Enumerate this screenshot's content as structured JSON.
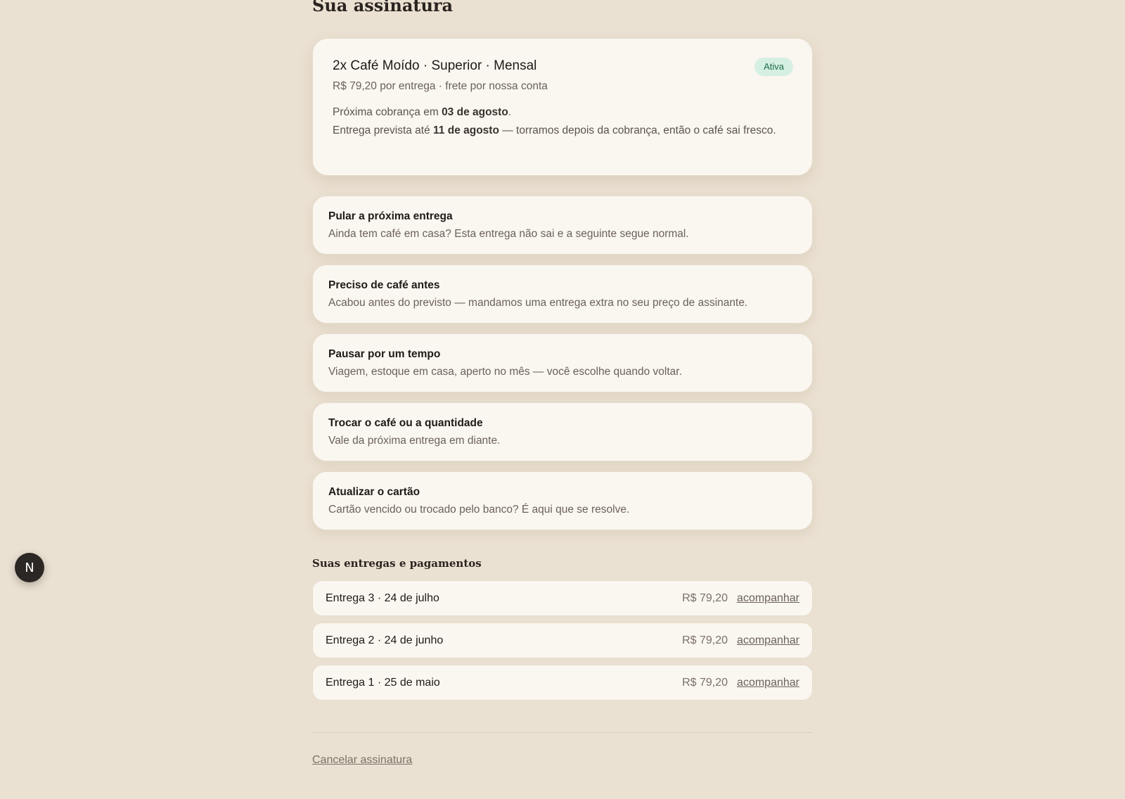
{
  "page": {
    "title": "Sua assinatura"
  },
  "subscription": {
    "title": "2x Café Moído · Superior · Mensal",
    "status": "Ativa",
    "price_line": "R$ 79,20 por entrega · frete por nossa conta",
    "next_charge_prefix": "Próxima cobrança em ",
    "next_charge_date": "03 de agosto",
    "next_charge_suffix": ".",
    "eta_prefix": "Entrega prevista até ",
    "eta_date": "11 de agosto",
    "eta_suffix": " — torramos depois da cobrança, então o café sai fresco."
  },
  "actions": [
    {
      "title": "Pular a próxima entrega",
      "description": "Ainda tem café em casa? Esta entrega não sai e a seguinte segue normal."
    },
    {
      "title": "Preciso de café antes",
      "description": "Acabou antes do previsto — mandamos uma entrega extra no seu preço de assinante."
    },
    {
      "title": "Pausar por um tempo",
      "description": "Viagem, estoque em casa, aperto no mês — você escolhe quando voltar."
    },
    {
      "title": "Trocar o café ou a quantidade",
      "description": "Vale da próxima entrega em diante."
    },
    {
      "title": "Atualizar o cartão",
      "description": "Cartão vencido ou trocado pelo banco? É aqui que se resolve."
    }
  ],
  "deliveries": {
    "section_title": "Suas entregas e pagamentos",
    "items": [
      {
        "label": "Entrega 3 · 24 de julho",
        "amount": "R$ 79,20",
        "link": "acompanhar"
      },
      {
        "label": "Entrega 2 · 24 de junho",
        "amount": "R$ 79,20",
        "link": "acompanhar"
      },
      {
        "label": "Entrega 1 · 25 de maio",
        "amount": "R$ 79,20",
        "link": "acompanhar"
      }
    ]
  },
  "footer": {
    "cancel_label": "Cancelar assinatura"
  },
  "fab": {
    "label": "N",
    "icon": "next-logo-icon"
  },
  "colors": {
    "background": "#ebe1d2",
    "card": "#faf6f0",
    "badge_bg": "#d5f0e2",
    "badge_text": "#1d6b48"
  }
}
